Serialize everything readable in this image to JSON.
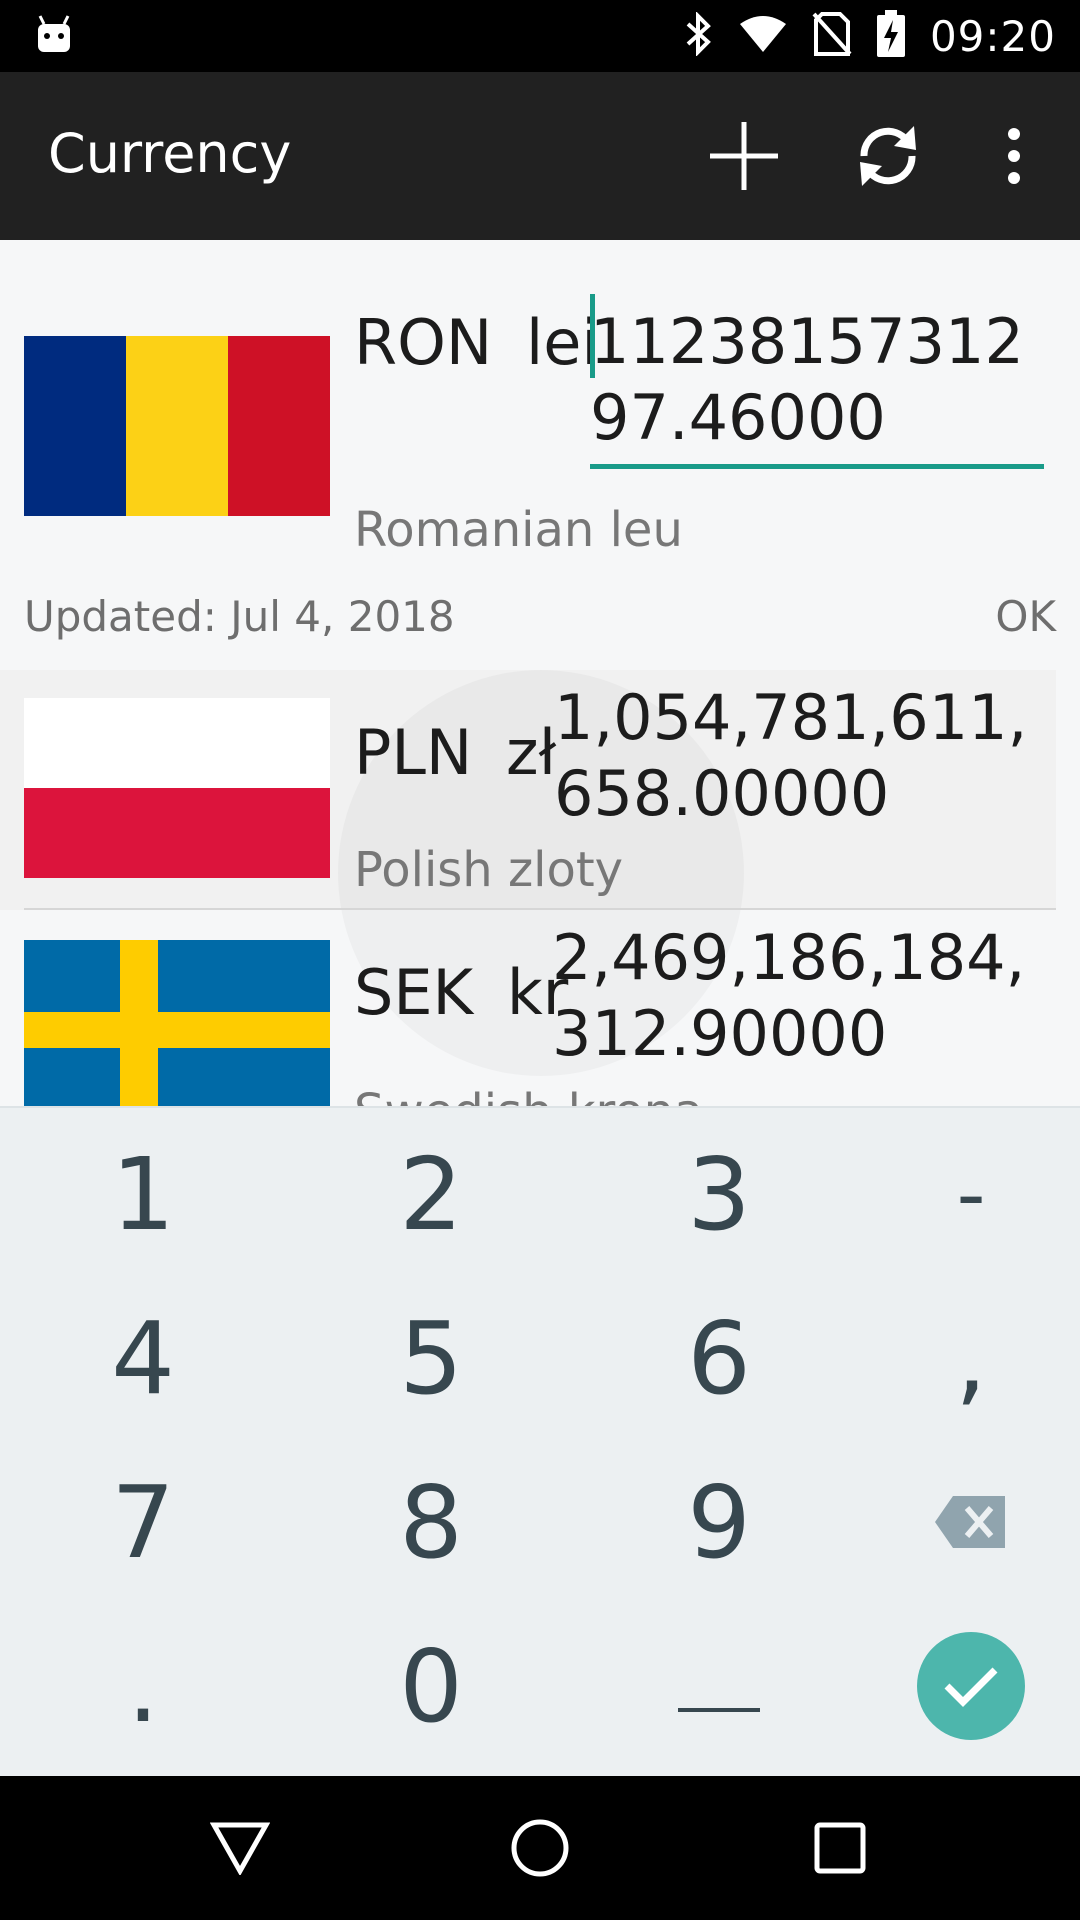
{
  "status_bar": {
    "time": "09:20",
    "icons": [
      "android-debug-icon",
      "bluetooth-icon",
      "wifi-icon",
      "no-sim-icon",
      "battery-charging-icon"
    ]
  },
  "app_bar": {
    "title": "Currency",
    "actions": [
      "add-icon",
      "refresh-icon",
      "more-vert-icon"
    ]
  },
  "selected": {
    "code": "RON",
    "symbol": "lei",
    "value": "1123815731297.46000",
    "name": "Romanian leu",
    "updated": "Updated: Jul 4, 2018",
    "status": "OK"
  },
  "rows": [
    {
      "code": "PLN",
      "symbol": "zł",
      "value": "1,054,781,611,658.00000",
      "name": "Polish zloty"
    },
    {
      "code": "SEK",
      "symbol": "kr",
      "value": "2,469,186,184,312.90000",
      "name": "Swedish krona"
    }
  ],
  "keypad": {
    "keys": [
      "1",
      "2",
      "3",
      "-",
      "4",
      "5",
      "6",
      ",",
      "7",
      "8",
      "9",
      "backspace",
      ".",
      "0",
      "space",
      "done"
    ]
  },
  "colors": {
    "accent": "#199b89",
    "done_button": "#4db6ac",
    "key_text": "#37474f",
    "app_bar": "#212121"
  },
  "nav_bar": {
    "buttons": [
      "back-icon",
      "home-icon",
      "recents-icon"
    ]
  }
}
